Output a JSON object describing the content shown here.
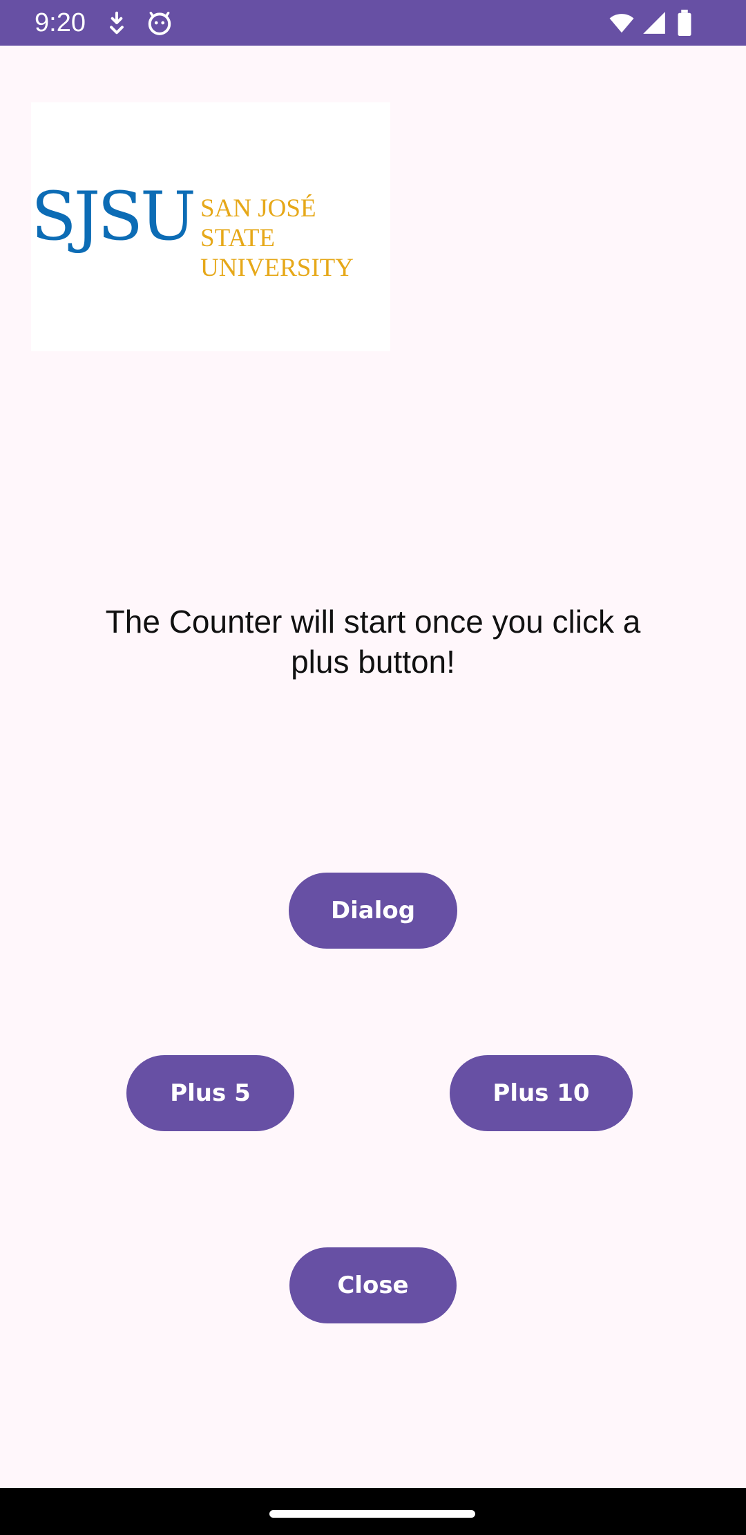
{
  "status_bar": {
    "time": "9:20",
    "background_color": "#6750A4",
    "icons": [
      "download-icon",
      "android-debug-icon",
      "wifi-icon",
      "signal-icon",
      "battery-icon"
    ]
  },
  "logo": {
    "acronym": "SJSU",
    "name": "SAN JOSÉ STATE\nUNIVERSITY",
    "acronym_color": "#0C6CB5",
    "name_color": "#E6A819"
  },
  "message": "The Counter will start once you click a plus button!",
  "buttons": {
    "dialog": "Dialog",
    "plus5": "Plus 5",
    "plus10": "Plus 10",
    "close": "Close",
    "color": "#6750A4"
  }
}
